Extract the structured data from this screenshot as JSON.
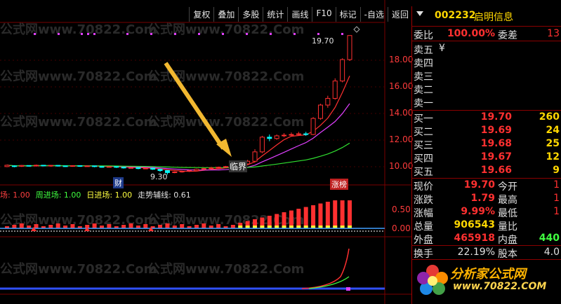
{
  "toolbar": {
    "buttons": [
      "复权",
      "叠加",
      "多股",
      "统计",
      "画线",
      "F10",
      "标记",
      "-自选",
      "返回"
    ]
  },
  "stock": {
    "code": "002232",
    "name": "启明信息"
  },
  "weibi": {
    "label": "委比",
    "value": "100.00%",
    "label2": "委差",
    "value2": "13"
  },
  "sell": [
    {
      "label": "卖五",
      "price": "¥",
      "vol": ""
    },
    {
      "label": "卖四",
      "price": "",
      "vol": ""
    },
    {
      "label": "卖三",
      "price": "",
      "vol": ""
    },
    {
      "label": "卖二",
      "price": "",
      "vol": ""
    },
    {
      "label": "卖一",
      "price": "",
      "vol": ""
    }
  ],
  "buy": [
    {
      "label": "买一",
      "price": "19.70",
      "vol": "260"
    },
    {
      "label": "买二",
      "price": "19.69",
      "vol": "24"
    },
    {
      "label": "买三",
      "price": "19.68",
      "vol": "25"
    },
    {
      "label": "买四",
      "price": "19.67",
      "vol": "12"
    },
    {
      "label": "买五",
      "price": "19.66",
      "vol": "9"
    }
  ],
  "quote": [
    {
      "l1": "现价",
      "v1": "19.70",
      "l2": "今开",
      "v2": "1"
    },
    {
      "l1": "涨跌",
      "v1": "1.79",
      "l2": "最高",
      "v2": "1"
    },
    {
      "l1": "涨幅",
      "v1": "9.99%",
      "l2": "最低",
      "v2": "1"
    },
    {
      "l1": "总量",
      "v1": "906543",
      "l2": "量比",
      "v2": ""
    },
    {
      "l1": "外盘",
      "v1": "465918",
      "l2": "内盘",
      "v2": "440"
    }
  ],
  "turnover": {
    "label": "换手",
    "value": "22.19%",
    "label2": "股本",
    "value2": "4.0"
  },
  "chart": {
    "price_axis": [
      "18.00",
      "16.00",
      "14.00",
      "12.00",
      "10.00"
    ],
    "ind_axis": [
      "0.50",
      "0.00"
    ],
    "high_tag": "19.70",
    "low_tag": "9.30",
    "lin_label": "临界",
    "zhang_label": "涨榜",
    "cai_label": "财",
    "indicators": [
      {
        "text": "场: 1.00",
        "color": "#ff4040"
      },
      {
        "text": "周进场: 1.00",
        "color": "#40ff40"
      },
      {
        "text": "日进场: 1.00",
        "color": "#ffff40"
      },
      {
        "text": "走势辅线: 0.61",
        "color": "#e0e0e0"
      }
    ],
    "colors": {
      "up": "#ff3030",
      "down": "#00ffff",
      "ma1": "#ff3030",
      "ma2": "#e040ff",
      "ma3": "#30e030",
      "arrow": "#f2b830"
    }
  },
  "watermark": {
    "text": "公式网www.70822.Com",
    "text2": "分析家公式网",
    "logo_main": "分析家公式网",
    "logo_url": "www.70822.COM"
  },
  "chart_data": {
    "type": "candlestick",
    "ylim": [
      9,
      20
    ],
    "candles": [
      [
        9.9,
        10.0,
        9.85,
        10.05
      ],
      [
        9.95,
        9.92,
        9.85,
        10.0
      ],
      [
        9.92,
        9.98,
        9.88,
        10.02
      ],
      [
        9.98,
        9.95,
        9.9,
        10.0
      ],
      [
        9.95,
        10.0,
        9.9,
        10.05
      ],
      [
        10.0,
        9.96,
        9.92,
        10.02
      ],
      [
        9.96,
        9.99,
        9.9,
        10.02
      ],
      [
        9.99,
        9.95,
        9.9,
        10.0
      ],
      [
        9.95,
        9.93,
        9.88,
        9.98
      ],
      [
        9.93,
        9.97,
        9.9,
        10.0
      ],
      [
        9.97,
        9.92,
        9.88,
        10.0
      ],
      [
        9.92,
        9.95,
        9.9,
        9.98
      ],
      [
        9.95,
        9.9,
        9.85,
        9.97
      ],
      [
        9.9,
        9.88,
        9.82,
        9.93
      ],
      [
        9.88,
        9.9,
        9.84,
        9.92
      ],
      [
        9.9,
        9.85,
        9.8,
        9.92
      ],
      [
        9.85,
        9.8,
        9.75,
        9.88
      ],
      [
        9.8,
        9.82,
        9.76,
        9.86
      ],
      [
        9.82,
        9.75,
        9.7,
        9.84
      ],
      [
        9.75,
        9.78,
        9.72,
        9.8
      ],
      [
        9.78,
        9.7,
        9.65,
        9.8
      ],
      [
        9.7,
        9.6,
        9.5,
        9.72
      ],
      [
        9.6,
        9.45,
        9.3,
        9.62
      ],
      [
        9.45,
        9.5,
        9.4,
        9.55
      ],
      [
        9.5,
        9.55,
        9.45,
        9.6
      ],
      [
        9.55,
        9.6,
        9.5,
        9.65
      ],
      [
        9.6,
        9.7,
        9.55,
        9.75
      ],
      [
        9.7,
        9.75,
        9.65,
        9.8
      ],
      [
        9.75,
        9.8,
        9.7,
        9.85
      ],
      [
        9.8,
        9.85,
        9.75,
        9.9
      ],
      [
        9.85,
        9.9,
        9.8,
        9.95
      ],
      [
        9.9,
        10.0,
        9.85,
        10.05
      ],
      [
        10.0,
        10.1,
        9.95,
        10.15
      ],
      [
        10.1,
        10.3,
        10.05,
        10.4
      ],
      [
        10.3,
        11.0,
        10.2,
        11.2
      ],
      [
        11.0,
        12.1,
        10.9,
        12.2
      ],
      [
        12.1,
        12.0,
        11.8,
        12.3
      ],
      [
        12.0,
        12.2,
        11.9,
        12.3
      ],
      [
        12.2,
        12.25,
        12.1,
        12.4
      ],
      [
        12.25,
        12.3,
        12.2,
        12.45
      ],
      [
        12.3,
        12.35,
        12.2,
        12.5
      ],
      [
        12.35,
        12.3,
        12.2,
        12.5
      ],
      [
        12.3,
        13.5,
        12.25,
        13.6
      ],
      [
        13.5,
        14.5,
        13.4,
        14.6
      ],
      [
        14.5,
        15.0,
        14.3,
        15.2
      ],
      [
        15.0,
        16.3,
        14.9,
        16.5
      ],
      [
        16.3,
        17.9,
        16.2,
        18.0
      ],
      [
        17.9,
        19.7,
        17.8,
        19.7
      ]
    ]
  }
}
